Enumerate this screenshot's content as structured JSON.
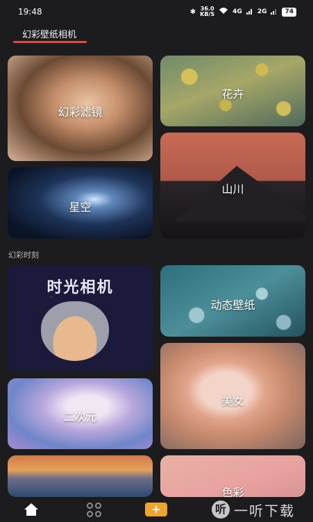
{
  "status_bar": {
    "time": "19:48",
    "bluetooth_icon": "bluetooth-icon",
    "net_speed_value": "36.0",
    "net_speed_unit": "KB/S",
    "wifi_icon": "wifi-icon",
    "signal_1": "4G",
    "signal_2": "2G",
    "battery": "74"
  },
  "header": {
    "tab_title": "幻彩壁纸相机",
    "accent_color": "#e14a45"
  },
  "cards_top": [
    {
      "label": "幻彩滤镜"
    },
    {
      "label": "花卉"
    },
    {
      "label": "星空"
    },
    {
      "label": "山川"
    }
  ],
  "section": {
    "title": "幻彩时刻"
  },
  "cards_moments": [
    {
      "title": "时光相机"
    },
    {
      "label": "动态壁纸"
    },
    {
      "label": "美女"
    },
    {
      "label": "二次元"
    },
    {
      "label": ""
    },
    {
      "label": "色彩"
    }
  ],
  "bottom_nav": {
    "home_icon": "home-icon",
    "apps_icon": "apps-grid-icon",
    "add_label": "+",
    "add_color": "#f0a52e"
  },
  "watermark": {
    "logo": "听",
    "text": "一听下载"
  }
}
